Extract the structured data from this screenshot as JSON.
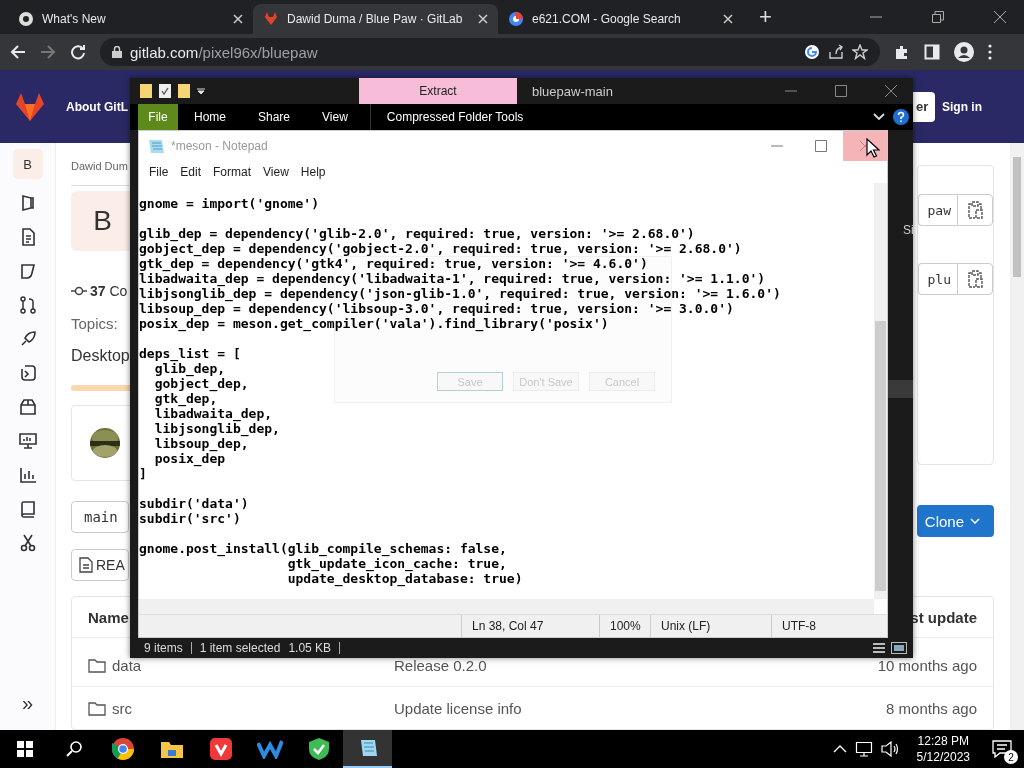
{
  "browser": {
    "tabs": [
      {
        "title": "What's New",
        "selected": false
      },
      {
        "title": "Dawid Duma / Blue Paw · GitLab",
        "selected": true
      },
      {
        "title": "e621.COM - Google Search",
        "selected": false
      }
    ],
    "new_tab": "+",
    "address": {
      "host": "gitlab.com",
      "path": "/pixel96x/bluepaw"
    }
  },
  "gitlab": {
    "header": {
      "about": "About GitL",
      "register": "er",
      "sign_in": "Sign in"
    },
    "sidebar": {
      "project_avatar": "B",
      "expand": "»"
    },
    "breadcrumb": "Dawid Dum",
    "avatar_letter": "B",
    "commits": {
      "count": "37",
      "label": "Co"
    },
    "topics_label": "Topics:",
    "description": "Desktop",
    "branch": "main",
    "readme": "REA",
    "clone_fields": [
      "paw",
      "plu"
    ],
    "clone_button": "Clone",
    "table": {
      "columns": [
        "Name",
        "st update"
      ],
      "rows": [
        {
          "name": "data",
          "commit": "Release 0.2.0",
          "updated": "10 months ago"
        },
        {
          "name": "src",
          "commit": "Update license info",
          "updated": "8 months ago"
        }
      ]
    }
  },
  "explorer": {
    "title": "bluepaw-main",
    "context_tab": "Extract",
    "ribbon_tabs": [
      {
        "label": "File",
        "kind": "menu"
      },
      {
        "label": "Home",
        "kind": "tab"
      },
      {
        "label": "Share",
        "kind": "tab"
      },
      {
        "label": "View",
        "kind": "tab"
      },
      {
        "label": "Compressed Folder Tools",
        "kind": "tab"
      }
    ],
    "column_header": "Si",
    "status": {
      "items": "9 items",
      "selection": "1 item selected",
      "size": "1.05 KB"
    }
  },
  "notepad": {
    "title": "*meson - Notepad",
    "menu": [
      "File",
      "Edit",
      "Format",
      "View",
      "Help"
    ],
    "text": "gnome = import('gnome')\n\nglib_dep = dependency('glib-2.0', required: true, version: '>= 2.68.0')\ngobject_dep = dependency('gobject-2.0', required: true, version: '>= 2.68.0')\ngtk_dep = dependency('gtk4', required: true, version: '>= 4.6.0')\nlibadwaita_dep = dependency('libadwaita-1', required: true, version: '>= 1.1.0')\nlibjsonglib_dep = dependency('json-glib-1.0', required: true, version: '>= 1.6.0')\nlibsoup_dep = dependency('libsoup-3.0', required: true, version: '>= 3.0.0')\nposix_dep = meson.get_compiler('vala').find_library('posix')\n\ndeps_list = [\n  glib_dep,\n  gobject_dep,\n  gtk_dep,\n  libadwaita_dep,\n  libjsonglib_dep,\n  libsoup_dep,\n  posix_dep\n]\n\nsubdir('data')\nsubdir('src')\n\ngnome.post_install(glib_compile_schemas: false,\n                   gtk_update_icon_cache: true,\n                   update_desktop_database: true)",
    "status": {
      "position": "Ln 38, Col 47",
      "zoom": "100%",
      "line_endings": "Unix (LF)",
      "encoding": "UTF-8"
    }
  },
  "save_dialog": {
    "buttons": [
      "Save",
      "Don't Save",
      "Cancel"
    ]
  },
  "taskbar": {
    "time": "12:28 PM",
    "date": "5/12/2023",
    "notifications": "2"
  }
}
